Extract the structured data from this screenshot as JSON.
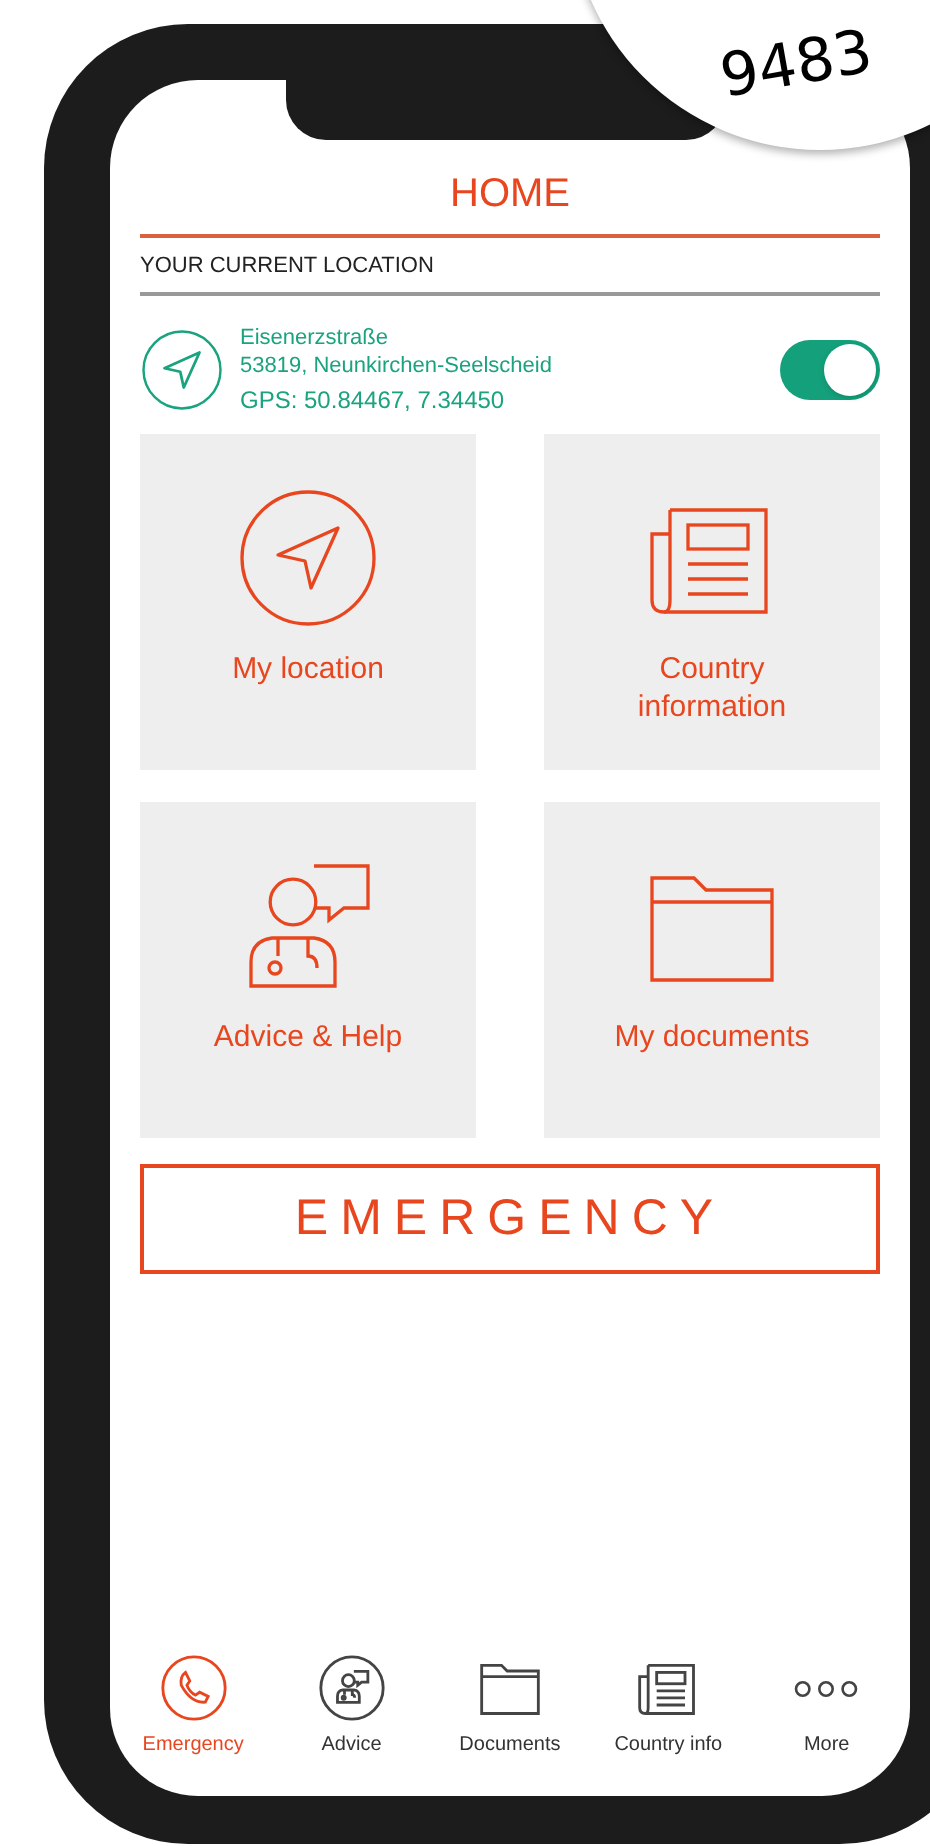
{
  "sticker": {
    "text": "9483"
  },
  "header": {
    "title": "HOME"
  },
  "location": {
    "section_label": "YOUR CURRENT LOCATION",
    "street": "Eisenerzstraße",
    "city": "53819, Neunkirchen-Seelscheid",
    "gps": "GPS: 50.84467, 7.34450",
    "tracking_on": true
  },
  "tiles": [
    {
      "kind": "location",
      "label": "My location"
    },
    {
      "kind": "country",
      "label": "Country information"
    },
    {
      "kind": "advice",
      "label": "Advice & Help"
    },
    {
      "kind": "documents",
      "label": "My documents"
    }
  ],
  "emergency_button": {
    "label": "EMERGENCY"
  },
  "tab_bar": [
    {
      "kind": "emergency",
      "label": "Emergency",
      "selected": true
    },
    {
      "kind": "advice",
      "label": "Advice",
      "selected": false
    },
    {
      "kind": "documents",
      "label": "Documents",
      "selected": false
    },
    {
      "kind": "country",
      "label": "Country info",
      "selected": false
    },
    {
      "kind": "more",
      "label": "More",
      "selected": false
    }
  ]
}
